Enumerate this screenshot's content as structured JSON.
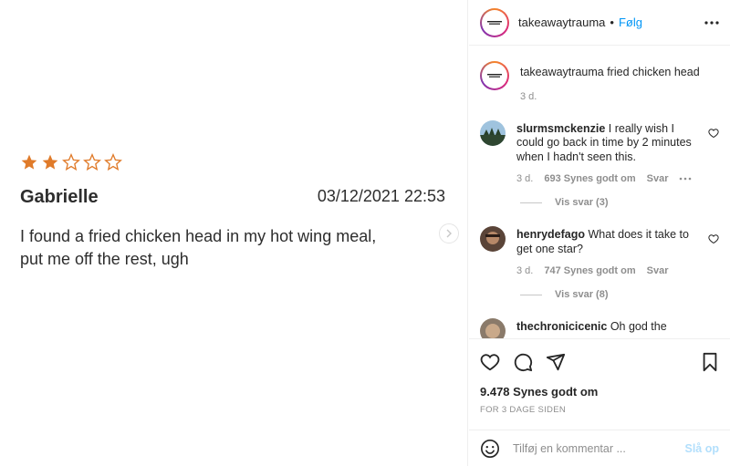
{
  "post_image": {
    "rating_filled": 2,
    "rating_total": 5,
    "star_color": "#e07b2a",
    "reviewer": "Gabrielle",
    "date": "03/12/2021 22:53",
    "review_line1": "I found a fried chicken head in my hot wing meal,",
    "review_line2": "put me off the rest, ugh"
  },
  "header": {
    "username": "takeawaytrauma",
    "separator": "•",
    "follow_label": "Følg"
  },
  "caption": {
    "username": "takeawaytrauma",
    "text": "fried chicken head",
    "age": "3 d."
  },
  "comments": [
    {
      "username": "slurmsmckenzie",
      "text": "I really wish I could go back in time by 2 minutes when I hadn't seen this.",
      "age": "3 d.",
      "likes": "693 Synes godt om",
      "reply": "Svar",
      "view_replies": "Vis svar (3)"
    },
    {
      "username": "henrydefago",
      "text": "What does it take to get one star?",
      "age": "3 d.",
      "likes": "747 Synes godt om",
      "reply": "Svar",
      "view_replies": "Vis svar (8)"
    },
    {
      "username": "thechronicicenic",
      "text": "Oh god the"
    }
  ],
  "actions": {
    "likes_count": "9.478 Synes godt om",
    "time_ago": "FOR 3 DAGE SIDEN"
  },
  "add_comment": {
    "placeholder": "Tilføj en kommentar ...",
    "post_label": "Slå op"
  },
  "colors": {
    "follow": "#0095f6",
    "muted": "#8e8e8e",
    "post_disabled": "#b2dffc"
  }
}
